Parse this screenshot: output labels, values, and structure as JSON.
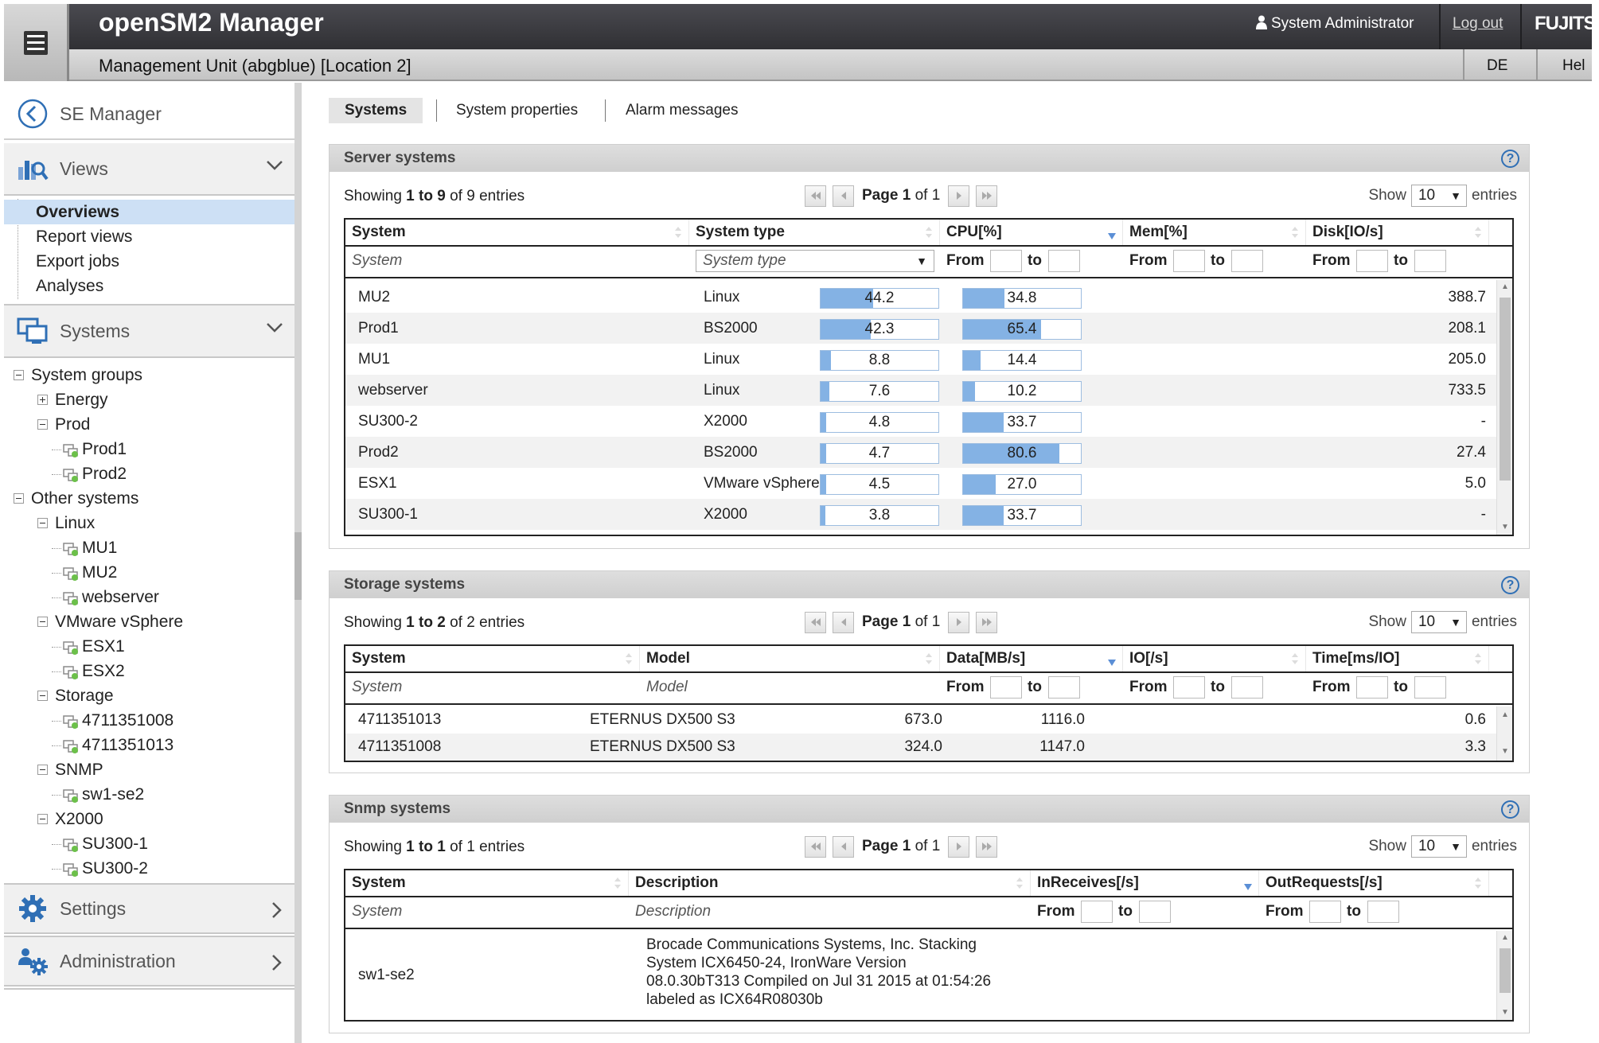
{
  "header": {
    "app_title": "openSM2 Manager",
    "user": "System Administrator",
    "logout": "Log out",
    "logo": "FUJITSU",
    "unit_title": "Management Unit (abgblue) [Location 2]",
    "language": "DE",
    "help": "Hel"
  },
  "sidebar": {
    "back_label": "SE Manager",
    "views_label": "Views",
    "view_items": [
      "Overviews",
      "Report views",
      "Export jobs",
      "Analyses"
    ],
    "systems_label": "Systems",
    "tree": [
      {
        "label": "System groups",
        "level": 0,
        "toggle": "minus"
      },
      {
        "label": "Energy",
        "level": 1,
        "toggle": "plus"
      },
      {
        "label": "Prod",
        "level": 1,
        "toggle": "minus"
      },
      {
        "label": "Prod1",
        "level": 2,
        "toggle": "none"
      },
      {
        "label": "Prod2",
        "level": 2,
        "toggle": "none"
      },
      {
        "label": "Other systems",
        "level": 0,
        "toggle": "minus"
      },
      {
        "label": "Linux",
        "level": 1,
        "toggle": "minus"
      },
      {
        "label": "MU1",
        "level": 2,
        "toggle": "none"
      },
      {
        "label": "MU2",
        "level": 2,
        "toggle": "none"
      },
      {
        "label": "webserver",
        "level": 2,
        "toggle": "none"
      },
      {
        "label": "VMware vSphere",
        "level": 1,
        "toggle": "minus"
      },
      {
        "label": "ESX1",
        "level": 2,
        "toggle": "none"
      },
      {
        "label": "ESX2",
        "level": 2,
        "toggle": "none"
      },
      {
        "label": "Storage",
        "level": 1,
        "toggle": "minus"
      },
      {
        "label": "4711351008",
        "level": 2,
        "toggle": "none"
      },
      {
        "label": "4711351013",
        "level": 2,
        "toggle": "none"
      },
      {
        "label": "SNMP",
        "level": 1,
        "toggle": "minus"
      },
      {
        "label": "sw1-se2",
        "level": 2,
        "toggle": "none"
      },
      {
        "label": "X2000",
        "level": 1,
        "toggle": "minus"
      },
      {
        "label": "SU300-1",
        "level": 2,
        "toggle": "none"
      },
      {
        "label": "SU300-2",
        "level": 2,
        "toggle": "none"
      }
    ],
    "settings_label": "Settings",
    "admin_label": "Administration"
  },
  "tabs": [
    "Systems",
    "System properties",
    "Alarm messages"
  ],
  "common": {
    "show": "Show",
    "entries": "entries",
    "page_size": "10",
    "from": "From",
    "to": "to",
    "page_word": "Page",
    "of_word": "of"
  },
  "server": {
    "title": "Server systems",
    "showing": {
      "pre": "Showing",
      "first": "1",
      "to": "to",
      "last": "9",
      "of": "of",
      "total": "9",
      "suffix": "entries"
    },
    "page": "1",
    "pages": "1",
    "columns": [
      "System",
      "System type",
      "CPU[%]",
      "Mem[%]",
      "Disk[IO/s]"
    ],
    "filter_system": "System",
    "filter_type": "System type",
    "rows": [
      {
        "system": "MU2",
        "type": "Linux",
        "cpu": 44.2,
        "cpu_label": "44.2",
        "mem": 34.8,
        "mem_label": "34.8",
        "disk": "388.7"
      },
      {
        "system": "Prod1",
        "type": "BS2000",
        "cpu": 42.3,
        "cpu_label": "42.3",
        "mem": 65.4,
        "mem_label": "65.4",
        "disk": "208.1"
      },
      {
        "system": "MU1",
        "type": "Linux",
        "cpu": 8.8,
        "cpu_label": "8.8",
        "mem": 14.4,
        "mem_label": "14.4",
        "disk": "205.0"
      },
      {
        "system": "webserver",
        "type": "Linux",
        "cpu": 7.6,
        "cpu_label": "7.6",
        "mem": 10.2,
        "mem_label": "10.2",
        "disk": "733.5"
      },
      {
        "system": "SU300-2",
        "type": "X2000",
        "cpu": 4.8,
        "cpu_label": "4.8",
        "mem": 33.7,
        "mem_label": "33.7",
        "disk": "-"
      },
      {
        "system": "Prod2",
        "type": "BS2000",
        "cpu": 4.7,
        "cpu_label": "4.7",
        "mem": 80.6,
        "mem_label": "80.6",
        "disk": "27.4"
      },
      {
        "system": "ESX1",
        "type": "VMware vSphere",
        "cpu": 4.5,
        "cpu_label": "4.5",
        "mem": 27.0,
        "mem_label": "27.0",
        "disk": "5.0"
      },
      {
        "system": "SU300-1",
        "type": "X2000",
        "cpu": 3.8,
        "cpu_label": "3.8",
        "mem": 33.7,
        "mem_label": "33.7",
        "disk": "-"
      }
    ]
  },
  "storage": {
    "title": "Storage systems",
    "showing": {
      "pre": "Showing",
      "first": "1",
      "to": "to",
      "last": "2",
      "of": "of",
      "total": "2",
      "suffix": "entries"
    },
    "page": "1",
    "pages": "1",
    "columns": [
      "System",
      "Model",
      "Data[MB/s]",
      "IO[/s]",
      "Time[ms/IO]"
    ],
    "filter_system": "System",
    "filter_model": "Model",
    "rows": [
      {
        "system": "4711351013",
        "model": "ETERNUS DX500 S3",
        "data": "673.0",
        "io": "1116.0",
        "time": "0.6"
      },
      {
        "system": "4711351008",
        "model": "ETERNUS DX500 S3",
        "data": "324.0",
        "io": "1147.0",
        "time": "3.3"
      }
    ]
  },
  "snmp": {
    "title": "Snmp systems",
    "showing": {
      "pre": "Showing",
      "first": "1",
      "to": "to",
      "last": "1",
      "of": "of",
      "total": "1",
      "suffix": "entries"
    },
    "page": "1",
    "pages": "1",
    "columns": [
      "System",
      "Description",
      "InReceives[/s]",
      "OutRequests[/s]"
    ],
    "filter_system": "System",
    "filter_desc": "Description",
    "rows": [
      {
        "system": "sw1-se2",
        "desc_lines": [
          "Brocade Communications Systems, Inc. Stacking",
          "System ICX6450-24, IronWare Version",
          "08.0.30bT313 Compiled on Jul 31 2015 at 01:54:26",
          "labeled as ICX64R08030b"
        ]
      }
    ]
  },
  "colors": {
    "header_bg": "#3a3a3e",
    "bar_fill": "#84b2e4",
    "active_nav": "#cde0f5",
    "help_icon": "#2f6fb5"
  }
}
